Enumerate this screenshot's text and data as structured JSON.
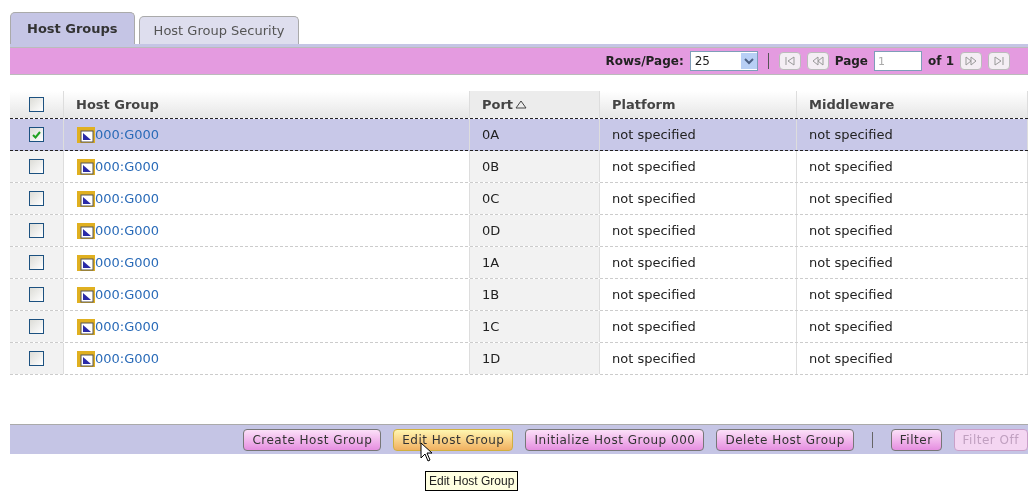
{
  "tabs": [
    {
      "label": "Host Groups",
      "selected": true
    },
    {
      "label": "Host Group Security",
      "selected": false
    }
  ],
  "pager": {
    "rows_label": "Rows/Page:",
    "rows_value": "25",
    "page_label": "Page",
    "page_placeholder": "1",
    "of_label": "of 1"
  },
  "table": {
    "select_all": {
      "checked": false
    },
    "columns": [
      {
        "label": "Host Group",
        "sorted": false
      },
      {
        "label": "Port",
        "sorted": true
      },
      {
        "label": "Platform",
        "sorted": false
      },
      {
        "label": "Middleware",
        "sorted": false
      }
    ],
    "rows": [
      {
        "checked": true,
        "selected": true,
        "cells": [
          "000:G000",
          "0A",
          "not specified",
          "not specified"
        ]
      },
      {
        "checked": false,
        "selected": false,
        "cells": [
          "000:G000",
          "0B",
          "not specified",
          "not specified"
        ]
      },
      {
        "checked": false,
        "selected": false,
        "cells": [
          "000:G000",
          "0C",
          "not specified",
          "not specified"
        ]
      },
      {
        "checked": false,
        "selected": false,
        "cells": [
          "000:G000",
          "0D",
          "not specified",
          "not specified"
        ]
      },
      {
        "checked": false,
        "selected": false,
        "cells": [
          "000:G000",
          "1A",
          "not specified",
          "not specified"
        ]
      },
      {
        "checked": false,
        "selected": false,
        "cells": [
          "000:G000",
          "1B",
          "not specified",
          "not specified"
        ]
      },
      {
        "checked": false,
        "selected": false,
        "cells": [
          "000:G000",
          "1C",
          "not specified",
          "not specified"
        ]
      },
      {
        "checked": false,
        "selected": false,
        "cells": [
          "000:G000",
          "1D",
          "not specified",
          "not specified"
        ]
      }
    ]
  },
  "actions": [
    {
      "label": "Create Host Group",
      "kind": "button",
      "hovered": false,
      "disabled": false
    },
    {
      "label": "Edit Host Group",
      "kind": "button",
      "hovered": true,
      "disabled": false
    },
    {
      "label": "Initialize Host Group 000",
      "kind": "button",
      "hovered": false,
      "disabled": false
    },
    {
      "label": "Delete Host Group",
      "kind": "button",
      "hovered": false,
      "disabled": false
    },
    {
      "kind": "separator"
    },
    {
      "label": "Filter",
      "kind": "button",
      "hovered": false,
      "disabled": false
    },
    {
      "label": "Filter Off",
      "kind": "button",
      "hovered": false,
      "disabled": true
    }
  ],
  "tooltip": "Edit Host Group"
}
